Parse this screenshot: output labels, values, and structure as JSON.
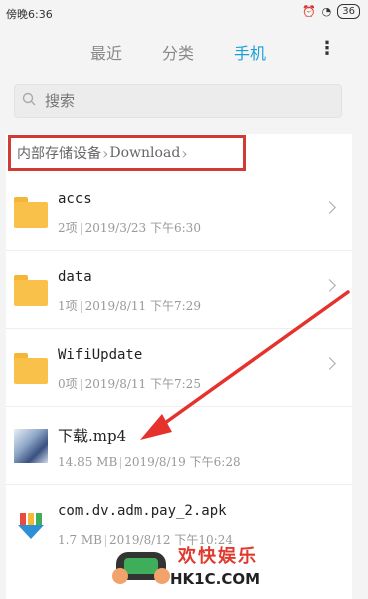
{
  "status_bar": {
    "time": "傍晚6:36",
    "battery": "36"
  },
  "tabs": [
    {
      "label": "最近",
      "active": false
    },
    {
      "label": "分类",
      "active": false
    },
    {
      "label": "手机",
      "active": true
    }
  ],
  "more_label": "⋮",
  "search": {
    "placeholder": "搜索"
  },
  "breadcrumb": {
    "root": "内部存储设备",
    "current": "Download"
  },
  "files": [
    {
      "name": "accs",
      "type": "folder",
      "size": "2项",
      "date": "2019/3/23",
      "time": "下午6:30"
    },
    {
      "name": "data",
      "type": "folder",
      "size": "1项",
      "date": "2019/8/11",
      "time": "下午7:29"
    },
    {
      "name": "WifiUpdate",
      "type": "folder",
      "size": "0项",
      "date": "2019/8/11",
      "time": "下午7:25"
    },
    {
      "name": "下载.mp4",
      "type": "video",
      "size": "14.85 MB",
      "date": "2019/8/19",
      "time": "下午6:28"
    },
    {
      "name": "com.dv.adm.pay_2.apk",
      "type": "apk",
      "size": "1.7 MB",
      "date": "2019/8/12",
      "time": "下午10:24"
    }
  ],
  "watermark": {
    "text": "欢快娱乐",
    "url": "HK1C.COM"
  },
  "colors": {
    "accent": "#1aa0d8",
    "folder": "#f9c04a",
    "highlight_box": "#d23b33",
    "arrow": "#e5322d"
  }
}
